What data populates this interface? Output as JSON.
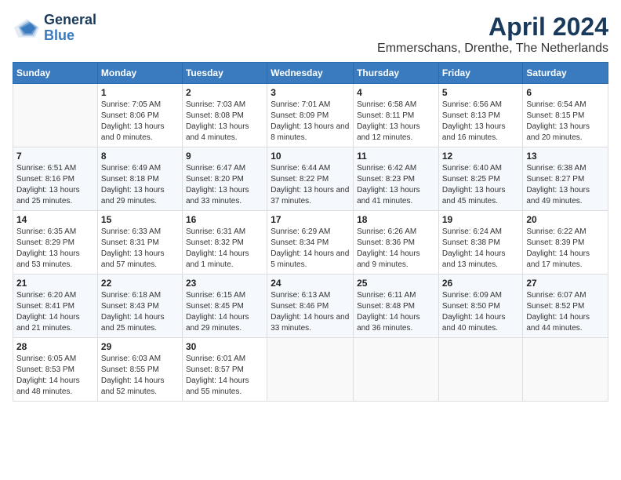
{
  "logo": {
    "line1": "General",
    "line2": "Blue"
  },
  "title": "April 2024",
  "subtitle": "Emmerschans, Drenthe, The Netherlands",
  "days_header": [
    "Sunday",
    "Monday",
    "Tuesday",
    "Wednesday",
    "Thursday",
    "Friday",
    "Saturday"
  ],
  "weeks": [
    [
      {
        "num": "",
        "sunrise": "",
        "sunset": "",
        "daylight": ""
      },
      {
        "num": "1",
        "sunrise": "Sunrise: 7:05 AM",
        "sunset": "Sunset: 8:06 PM",
        "daylight": "Daylight: 13 hours and 0 minutes."
      },
      {
        "num": "2",
        "sunrise": "Sunrise: 7:03 AM",
        "sunset": "Sunset: 8:08 PM",
        "daylight": "Daylight: 13 hours and 4 minutes."
      },
      {
        "num": "3",
        "sunrise": "Sunrise: 7:01 AM",
        "sunset": "Sunset: 8:09 PM",
        "daylight": "Daylight: 13 hours and 8 minutes."
      },
      {
        "num": "4",
        "sunrise": "Sunrise: 6:58 AM",
        "sunset": "Sunset: 8:11 PM",
        "daylight": "Daylight: 13 hours and 12 minutes."
      },
      {
        "num": "5",
        "sunrise": "Sunrise: 6:56 AM",
        "sunset": "Sunset: 8:13 PM",
        "daylight": "Daylight: 13 hours and 16 minutes."
      },
      {
        "num": "6",
        "sunrise": "Sunrise: 6:54 AM",
        "sunset": "Sunset: 8:15 PM",
        "daylight": "Daylight: 13 hours and 20 minutes."
      }
    ],
    [
      {
        "num": "7",
        "sunrise": "Sunrise: 6:51 AM",
        "sunset": "Sunset: 8:16 PM",
        "daylight": "Daylight: 13 hours and 25 minutes."
      },
      {
        "num": "8",
        "sunrise": "Sunrise: 6:49 AM",
        "sunset": "Sunset: 8:18 PM",
        "daylight": "Daylight: 13 hours and 29 minutes."
      },
      {
        "num": "9",
        "sunrise": "Sunrise: 6:47 AM",
        "sunset": "Sunset: 8:20 PM",
        "daylight": "Daylight: 13 hours and 33 minutes."
      },
      {
        "num": "10",
        "sunrise": "Sunrise: 6:44 AM",
        "sunset": "Sunset: 8:22 PM",
        "daylight": "Daylight: 13 hours and 37 minutes."
      },
      {
        "num": "11",
        "sunrise": "Sunrise: 6:42 AM",
        "sunset": "Sunset: 8:23 PM",
        "daylight": "Daylight: 13 hours and 41 minutes."
      },
      {
        "num": "12",
        "sunrise": "Sunrise: 6:40 AM",
        "sunset": "Sunset: 8:25 PM",
        "daylight": "Daylight: 13 hours and 45 minutes."
      },
      {
        "num": "13",
        "sunrise": "Sunrise: 6:38 AM",
        "sunset": "Sunset: 8:27 PM",
        "daylight": "Daylight: 13 hours and 49 minutes."
      }
    ],
    [
      {
        "num": "14",
        "sunrise": "Sunrise: 6:35 AM",
        "sunset": "Sunset: 8:29 PM",
        "daylight": "Daylight: 13 hours and 53 minutes."
      },
      {
        "num": "15",
        "sunrise": "Sunrise: 6:33 AM",
        "sunset": "Sunset: 8:31 PM",
        "daylight": "Daylight: 13 hours and 57 minutes."
      },
      {
        "num": "16",
        "sunrise": "Sunrise: 6:31 AM",
        "sunset": "Sunset: 8:32 PM",
        "daylight": "Daylight: 14 hours and 1 minute."
      },
      {
        "num": "17",
        "sunrise": "Sunrise: 6:29 AM",
        "sunset": "Sunset: 8:34 PM",
        "daylight": "Daylight: 14 hours and 5 minutes."
      },
      {
        "num": "18",
        "sunrise": "Sunrise: 6:26 AM",
        "sunset": "Sunset: 8:36 PM",
        "daylight": "Daylight: 14 hours and 9 minutes."
      },
      {
        "num": "19",
        "sunrise": "Sunrise: 6:24 AM",
        "sunset": "Sunset: 8:38 PM",
        "daylight": "Daylight: 14 hours and 13 minutes."
      },
      {
        "num": "20",
        "sunrise": "Sunrise: 6:22 AM",
        "sunset": "Sunset: 8:39 PM",
        "daylight": "Daylight: 14 hours and 17 minutes."
      }
    ],
    [
      {
        "num": "21",
        "sunrise": "Sunrise: 6:20 AM",
        "sunset": "Sunset: 8:41 PM",
        "daylight": "Daylight: 14 hours and 21 minutes."
      },
      {
        "num": "22",
        "sunrise": "Sunrise: 6:18 AM",
        "sunset": "Sunset: 8:43 PM",
        "daylight": "Daylight: 14 hours and 25 minutes."
      },
      {
        "num": "23",
        "sunrise": "Sunrise: 6:15 AM",
        "sunset": "Sunset: 8:45 PM",
        "daylight": "Daylight: 14 hours and 29 minutes."
      },
      {
        "num": "24",
        "sunrise": "Sunrise: 6:13 AM",
        "sunset": "Sunset: 8:46 PM",
        "daylight": "Daylight: 14 hours and 33 minutes."
      },
      {
        "num": "25",
        "sunrise": "Sunrise: 6:11 AM",
        "sunset": "Sunset: 8:48 PM",
        "daylight": "Daylight: 14 hours and 36 minutes."
      },
      {
        "num": "26",
        "sunrise": "Sunrise: 6:09 AM",
        "sunset": "Sunset: 8:50 PM",
        "daylight": "Daylight: 14 hours and 40 minutes."
      },
      {
        "num": "27",
        "sunrise": "Sunrise: 6:07 AM",
        "sunset": "Sunset: 8:52 PM",
        "daylight": "Daylight: 14 hours and 44 minutes."
      }
    ],
    [
      {
        "num": "28",
        "sunrise": "Sunrise: 6:05 AM",
        "sunset": "Sunset: 8:53 PM",
        "daylight": "Daylight: 14 hours and 48 minutes."
      },
      {
        "num": "29",
        "sunrise": "Sunrise: 6:03 AM",
        "sunset": "Sunset: 8:55 PM",
        "daylight": "Daylight: 14 hours and 52 minutes."
      },
      {
        "num": "30",
        "sunrise": "Sunrise: 6:01 AM",
        "sunset": "Sunset: 8:57 PM",
        "daylight": "Daylight: 14 hours and 55 minutes."
      },
      {
        "num": "",
        "sunrise": "",
        "sunset": "",
        "daylight": ""
      },
      {
        "num": "",
        "sunrise": "",
        "sunset": "",
        "daylight": ""
      },
      {
        "num": "",
        "sunrise": "",
        "sunset": "",
        "daylight": ""
      },
      {
        "num": "",
        "sunrise": "",
        "sunset": "",
        "daylight": ""
      }
    ]
  ]
}
